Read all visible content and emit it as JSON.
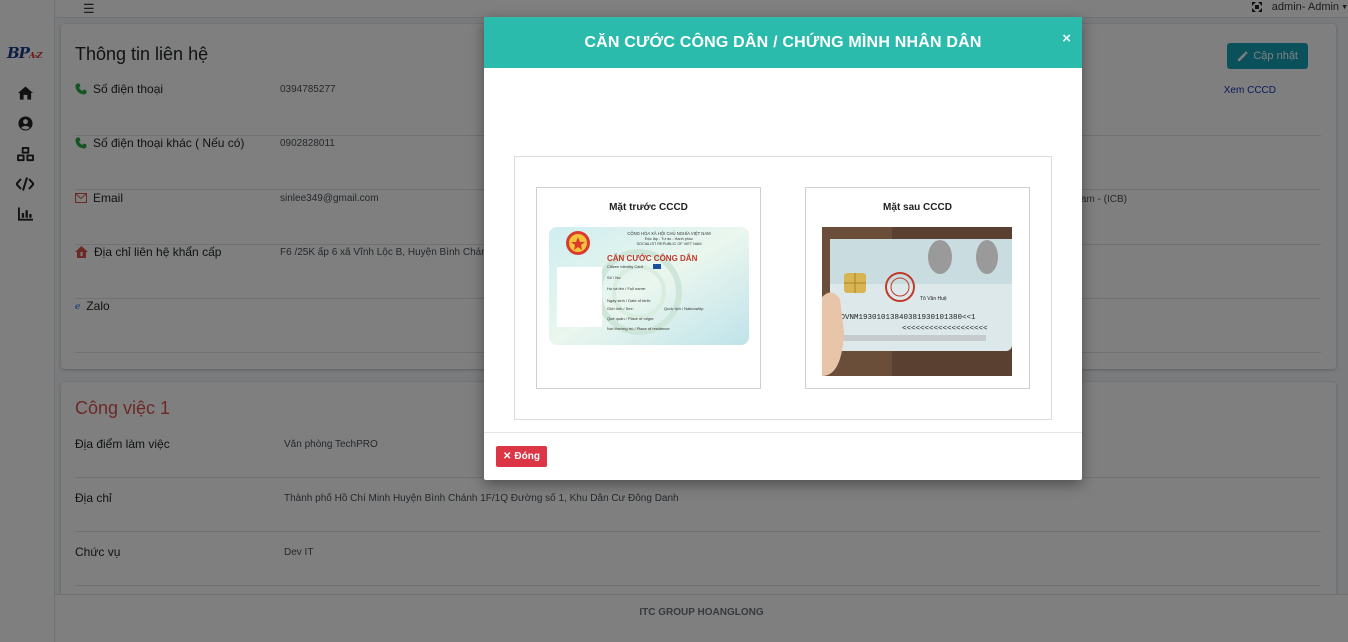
{
  "topbar": {
    "user_label": "admin- Admin"
  },
  "sidebar": {
    "logo_text": "BP",
    "logo_sub": "A-Z",
    "icons": [
      "home-icon",
      "user-circle-icon",
      "cubes-icon",
      "code-icon",
      "chart-icon"
    ]
  },
  "contact": {
    "title": "Thông tin liên hệ",
    "update_label": "Cập nhật",
    "view_link": "Xem CCCD",
    "side_text": "am - (ICB)",
    "rows": [
      {
        "label": "Số điện thoại",
        "value": "0394785277"
      },
      {
        "label": "Số điện thoại khác ( Nếu có)",
        "value": "0902828011"
      },
      {
        "label": "Email",
        "value": "sinlee349@gmail.com"
      },
      {
        "label": "Địa chỉ liên hệ khẩn cấp",
        "value": "F6 /25K ấp 6 xã Vĩnh Lộc B, Huyện Bình Chánh"
      },
      {
        "label": "Zalo",
        "value": ""
      }
    ]
  },
  "work": {
    "title": "Công việc 1",
    "rows": [
      {
        "label": "Địa điểm làm việc",
        "value": "Văn phòng TechPRO"
      },
      {
        "label": "Địa chỉ",
        "value": "Thành phố Hồ Chí Minh Huyện Bình Chánh 1F/1Q Đường số 1, Khu Dân Cư Đông Danh"
      },
      {
        "label": "Chức vụ",
        "value": "Dev IT"
      }
    ]
  },
  "footer": {
    "text": "ITC GROUP HOANGLONG"
  },
  "modal": {
    "title": "CĂN CƯỚC CÔNG DÂN / CHỨNG MÌNH NHÂN DÂN",
    "close_x": "×",
    "front_caption": "Mặt trước CCCD",
    "back_caption": "Mặt sau CCCD",
    "close_label": "Đóng",
    "front_card": {
      "header1": "CỘNG HÒA XÃ HỘI CHỦ NGHĨA VIỆT NAM",
      "header2": "Độc lập - Tự do - Hạnh phúc",
      "header3": "SOCIALIST REPUBLIC OF VIET NAM",
      "title": "CĂN CƯỚC CÔNG DÂN",
      "subtitle": "Citizen Identity Card",
      "fields": [
        "Số / No:",
        "Họ và tên / Full name:",
        "Ngày sinh / Date of birth:",
        "Giới tính / Sex:",
        "Quốc tịch / Nationality:",
        "Quê quán / Place of origin:",
        "Nơi thường trú / Place of residence"
      ]
    },
    "back_card": {
      "mrz1": "IDVNM19301013840381930101380<<1",
      "mrz2": "<<<<<<<<<<<<<<<<<<<",
      "signer": "Tô Văn Huệ"
    }
  }
}
